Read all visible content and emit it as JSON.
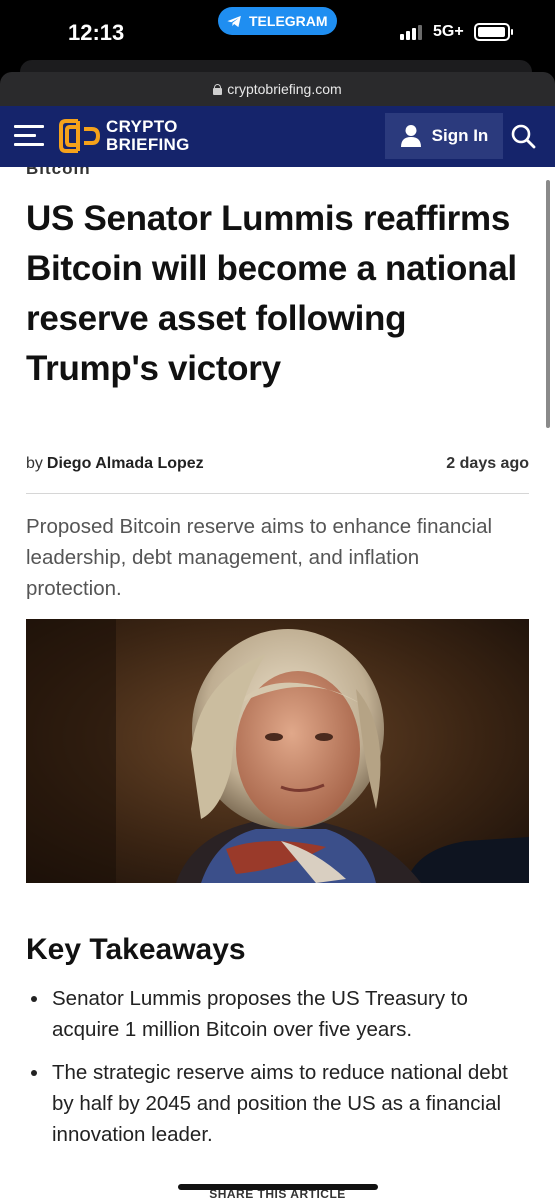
{
  "status_bar": {
    "time": "12:13",
    "notification_pill": "TELEGRAM",
    "network": "5G+"
  },
  "browser": {
    "url": "cryptobriefing.com"
  },
  "site": {
    "brand_line1": "CRYPTO",
    "brand_line2": "BRIEFING",
    "sign_in_label": "Sign In",
    "brand_color": "#15246b",
    "accent_color": "#f5a21b"
  },
  "article": {
    "category": "Bitcoin",
    "headline": "US Senator Lummis reaffirms Bitcoin will become a national reserve asset following Trump's victory",
    "by_label": "by",
    "author": "Diego Almada Lopez",
    "date": "2 days ago",
    "subtitle": "Proposed Bitcoin reserve aims to enhance financial leadership, debt management, and inflation protection.",
    "key_takeaways_title": "Key Takeaways",
    "key_takeaways": [
      "Senator Lummis proposes the US Treasury to acquire 1 million Bitcoin over five years.",
      "The strategic reserve aims to reduce national debt by half by 2045 and position the US as a financial innovation leader."
    ],
    "share_label": "SHARE THIS ARTICLE"
  }
}
